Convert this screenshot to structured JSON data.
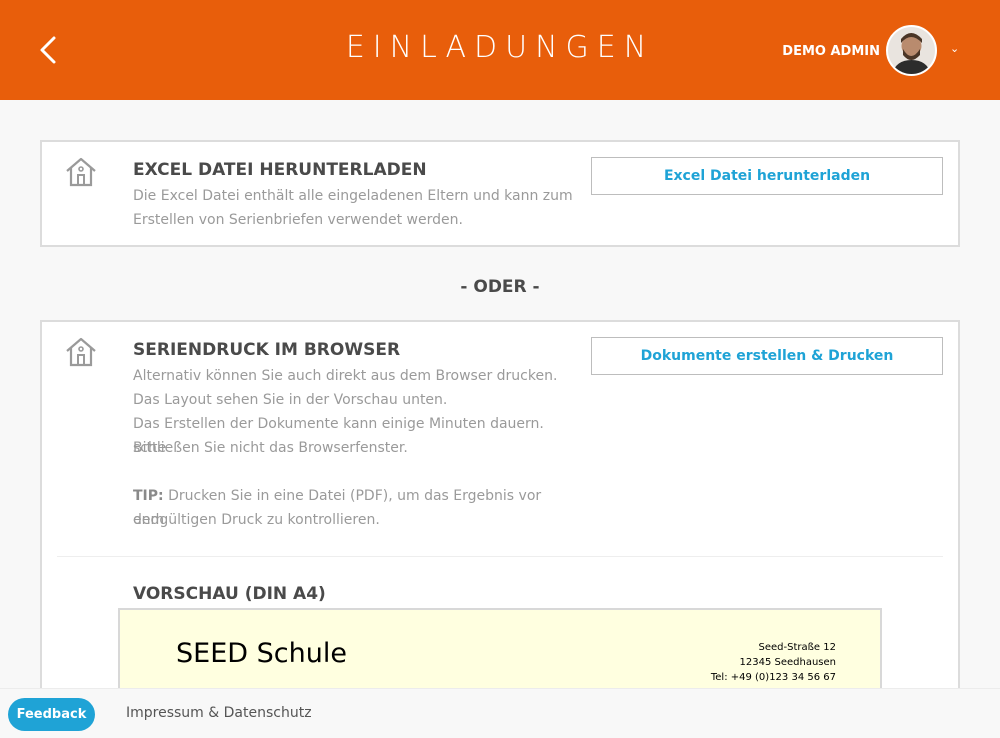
{
  "header": {
    "title": "EINLADUNGEN",
    "user_name": "DEMO ADMIN",
    "back_icon": "chevron-left-icon",
    "user_menu_icon": "chevron-down-icon",
    "color": "#e85e0b"
  },
  "excel_card": {
    "heading": "EXCEL DATEI HERUNTERLADEN",
    "text_line1": "Die Excel Datei enthält alle eingeladenen Eltern und kann zum",
    "text_line2": "Erstellen von Serienbriefen verwendet werden.",
    "button_label": "Excel Datei herunterladen",
    "icon": "house-icon"
  },
  "separator": {
    "label": "- ODER -"
  },
  "print_card": {
    "heading": "SERIENDRUCK IM BROWSER",
    "line1": "Alternativ können Sie auch direkt aus dem Browser drucken.",
    "line2": "Das Layout sehen Sie in der Vorschau unten.",
    "line3": "Das Erstellen der Dokumente kann einige Minuten dauern. Bitte",
    "line4": "schließen Sie nicht das Browserfenster.",
    "tip_label": "TIP:",
    "tip_line1": " Drucken Sie in eine Datei (PDF), um das Ergebnis vor dem",
    "tip_line2": "endgültigen Druck zu kontrollieren.",
    "button_label": "Dokumente erstellen & Drucken",
    "icon": "house-icon"
  },
  "preview": {
    "heading": "VORSCHAU (DIN A4)",
    "school_name": "SEED Schule",
    "address_line1": "Seed-Straße 12",
    "address_line2": "12345 Seedhausen",
    "address_line3": "Tel: +49 (0)123 34 56 67"
  },
  "footer": {
    "feedback_label": "Feedback",
    "impressum_label": "Impressum & Datenschutz"
  },
  "colors": {
    "accent": "#e85e0b",
    "link": "#1fa3d6"
  }
}
